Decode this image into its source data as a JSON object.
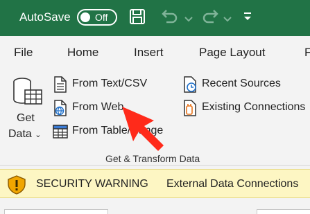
{
  "titlebar": {
    "autosave_label": "AutoSave",
    "autosave_state": "Off",
    "accent_color": "#217346"
  },
  "tabs": [
    {
      "label": "File"
    },
    {
      "label": "Home"
    },
    {
      "label": "Insert"
    },
    {
      "label": "Page Layout"
    },
    {
      "label": "F"
    }
  ],
  "get_transform": {
    "get_data": {
      "line1": "Get",
      "line2": "Data",
      "icon": "database-icon"
    },
    "commands": {
      "from_text_csv": {
        "label": "From Text/CSV",
        "icon": "text-file-icon"
      },
      "from_web": {
        "label": "From Web",
        "icon": "web-page-icon"
      },
      "from_table_range": {
        "label": "From Table/Range",
        "icon": "table-icon"
      },
      "recent_sources": {
        "label": "Recent Sources",
        "icon": "recent-sources-icon"
      },
      "existing_connections": {
        "label": "Existing Connections",
        "icon": "existing-connections-icon"
      }
    },
    "group_label": "Get & Transform Data"
  },
  "annotation": {
    "color": "#ff2a1a",
    "icon": "pointer-arrow"
  },
  "message_bar": {
    "title": "SECURITY WARNING",
    "text": "External Data Connections",
    "icon": "warning-shield-icon",
    "background": "#fdf6c3"
  }
}
